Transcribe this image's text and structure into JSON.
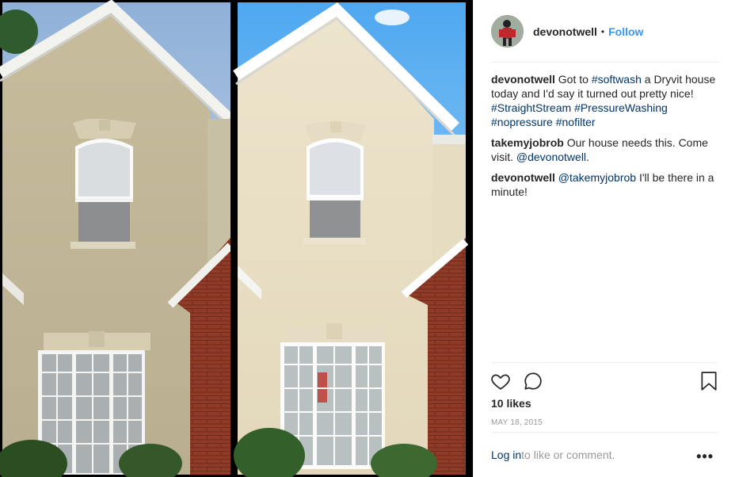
{
  "post": {
    "username": "devonotwell",
    "separator": "•",
    "follow_label": "Follow",
    "photo_description_icon": "before-after-house-photo"
  },
  "comments": [
    {
      "user": "devonotwell",
      "parts": [
        {
          "t": "text",
          "v": " Got to "
        },
        {
          "t": "tag",
          "v": "#softwash"
        },
        {
          "t": "text",
          "v": " a Dryvit house today and I'd say it turned out pretty nice! "
        },
        {
          "t": "tag",
          "v": "#StraightStream"
        },
        {
          "t": "text",
          "v": " "
        },
        {
          "t": "tag",
          "v": "#PressureWashing"
        },
        {
          "t": "text",
          "v": " "
        },
        {
          "t": "tag",
          "v": "#nopressure"
        },
        {
          "t": "text",
          "v": " "
        },
        {
          "t": "tag",
          "v": "#nofilter"
        }
      ]
    },
    {
      "user": "takemyjobrob",
      "parts": [
        {
          "t": "text",
          "v": " Our house needs this. Come visit. "
        },
        {
          "t": "tag",
          "v": "@devonotwell"
        },
        {
          "t": "text",
          "v": "."
        }
      ]
    },
    {
      "user": "devonotwell",
      "parts": [
        {
          "t": "text",
          "v": " "
        },
        {
          "t": "tag",
          "v": "@takemyjobrob"
        },
        {
          "t": "text",
          "v": " I'll be there in a minute!"
        }
      ]
    }
  ],
  "likes_label": "10 likes",
  "date_label": "MAY 18, 2015",
  "footer": {
    "login_label": "Log in",
    "rest_label": " to like or comment.",
    "more_label": "•••"
  },
  "colors": {
    "link": "#003569",
    "follow": "#3897f0",
    "muted": "#999999"
  }
}
